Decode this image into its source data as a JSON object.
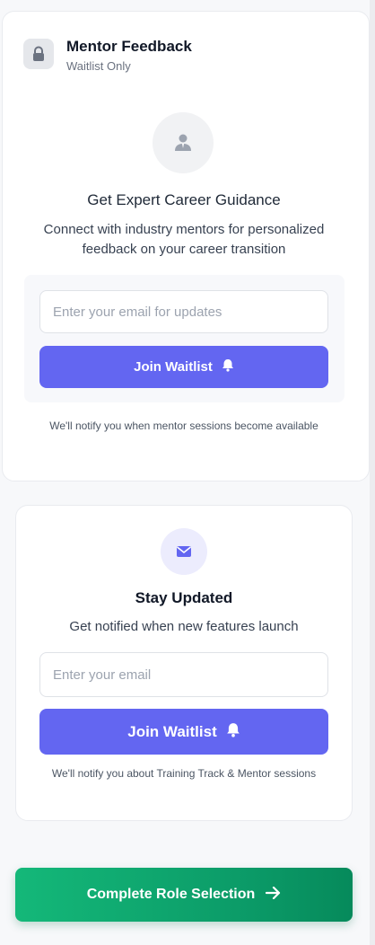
{
  "mentor_card": {
    "title": "Mentor Feedback",
    "status": "Waitlist Only",
    "lock_icon": "lock-icon",
    "avatar_icon": "person-icon",
    "heading": "Get Expert Career Guidance",
    "description": "Connect with industry mentors for personalized feedback on your career transition",
    "email_placeholder": "Enter your email for updates",
    "button_label": "Join Waitlist",
    "button_icon": "bell-icon",
    "note": "We'll notify you when mentor sessions become available"
  },
  "updates_card": {
    "icon": "mail-icon",
    "title": "Stay Updated",
    "description": "Get notified when new features launch",
    "email_placeholder": "Enter your email",
    "button_label": "Join Waitlist",
    "button_icon": "bell-icon",
    "note": "We'll notify you about Training Track & Mentor sessions"
  },
  "footer": {
    "complete_label": "Complete Role Selection",
    "arrow_icon": "arrow-right-icon"
  },
  "colors": {
    "primary": "#6366f1",
    "success_start": "#14b879",
    "success_end": "#068a5b"
  }
}
